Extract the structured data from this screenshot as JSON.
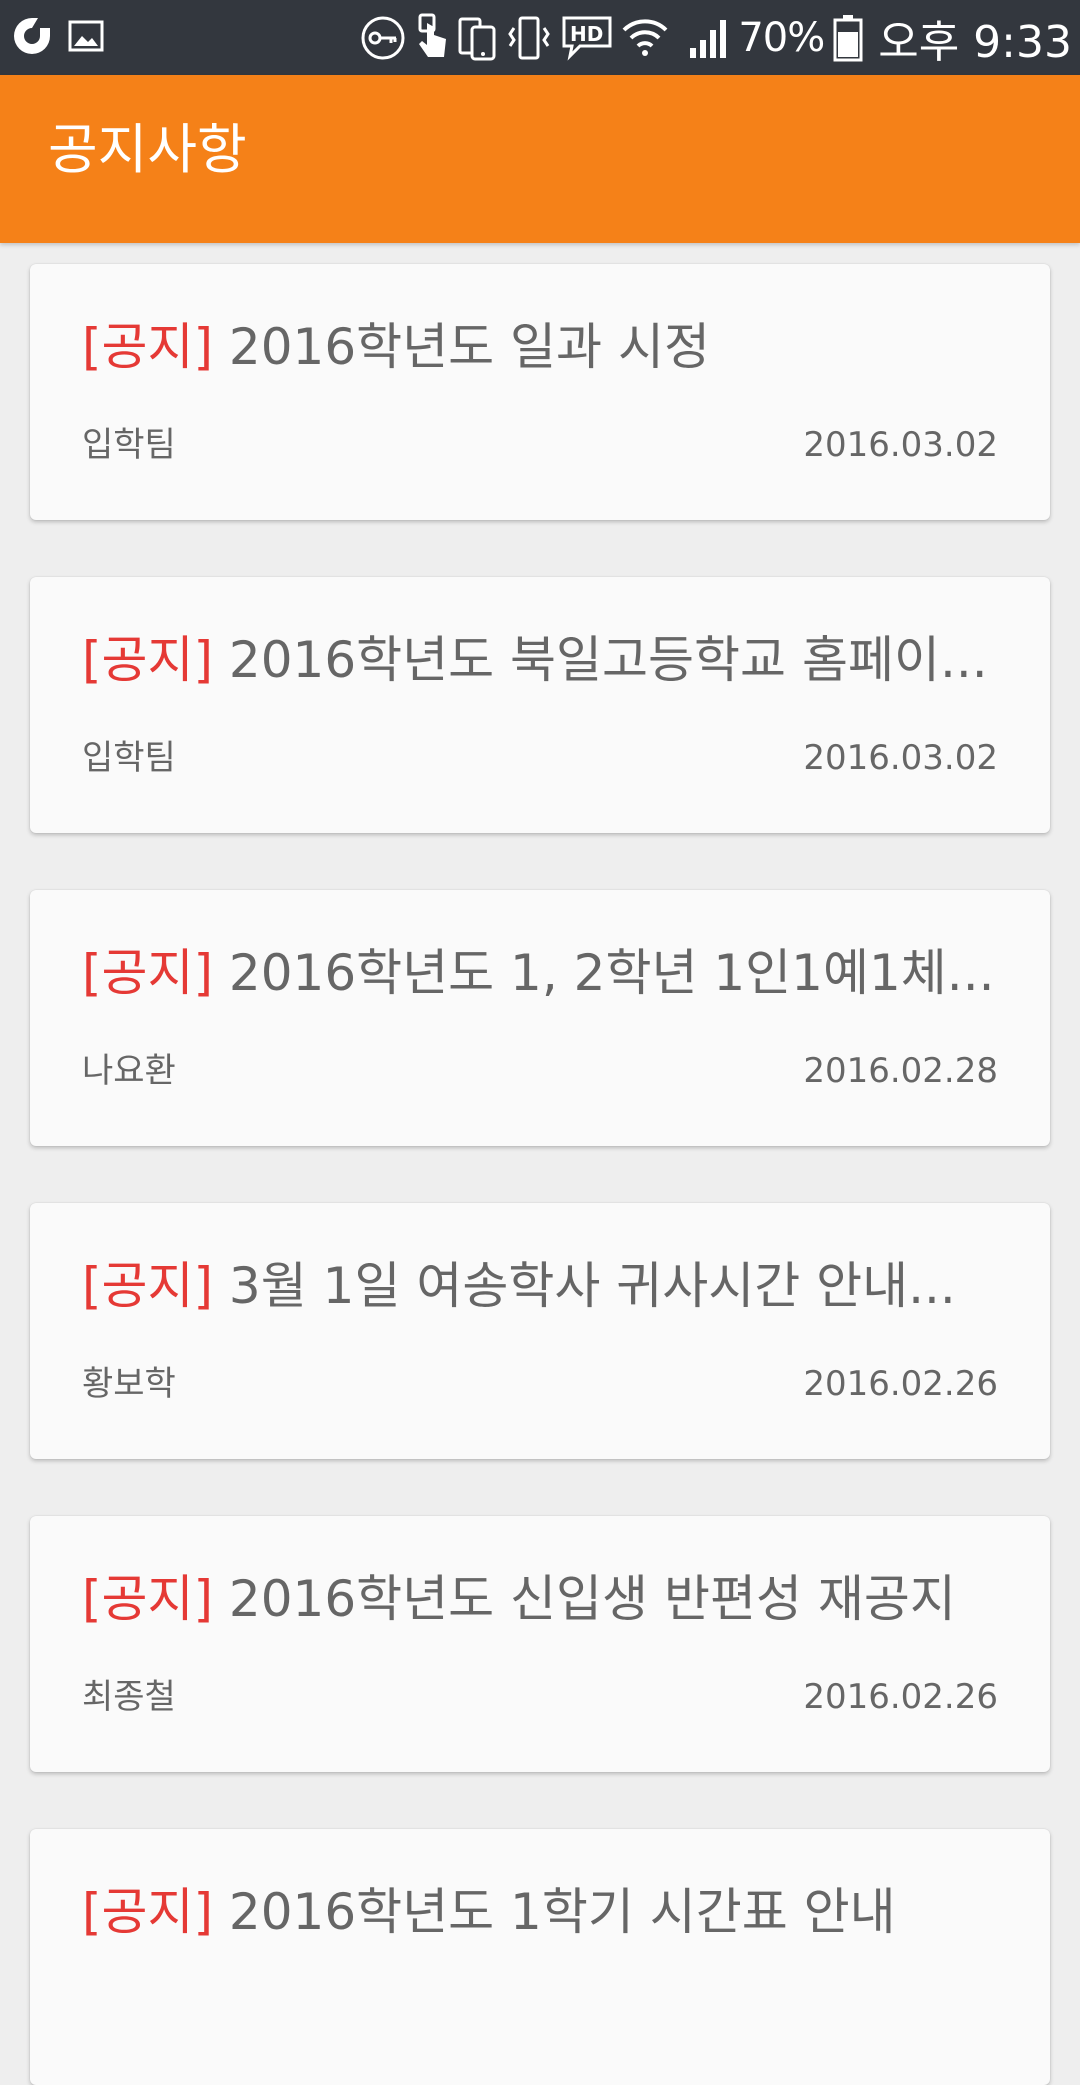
{
  "status_bar": {
    "battery": "70%",
    "time": "오후 9:33"
  },
  "app_bar": {
    "title": "공지사항"
  },
  "notices": [
    {
      "tag": "[공지]",
      "title": "2016학년도 일과 시정",
      "author": "입학팀",
      "date": "2016.03.02"
    },
    {
      "tag": "[공지]",
      "title": "2016학년도 북일고등학교 홈페이...",
      "author": "입학팀",
      "date": "2016.03.02"
    },
    {
      "tag": "[공지]",
      "title": "2016학년도 1, 2학년 1인1예1체...",
      "author": "나요환",
      "date": "2016.02.28"
    },
    {
      "tag": "[공지]",
      "title": "3월 1일 여송학사 귀사시간 안내...",
      "author": "황보학",
      "date": "2016.02.26"
    },
    {
      "tag": "[공지]",
      "title": "2016학년도 신입생 반편성 재공지",
      "author": "최종철",
      "date": "2016.02.26"
    },
    {
      "tag": "[공지]",
      "title": "2016학년도 1학기 시간표 안내",
      "author": "",
      "date": ""
    }
  ],
  "colors": {
    "status_bar": "#33373e",
    "app_bar": "#f58118",
    "tag": "#e53935",
    "text": "#666666",
    "background": "#eeeeee",
    "card": "#fafafa"
  }
}
